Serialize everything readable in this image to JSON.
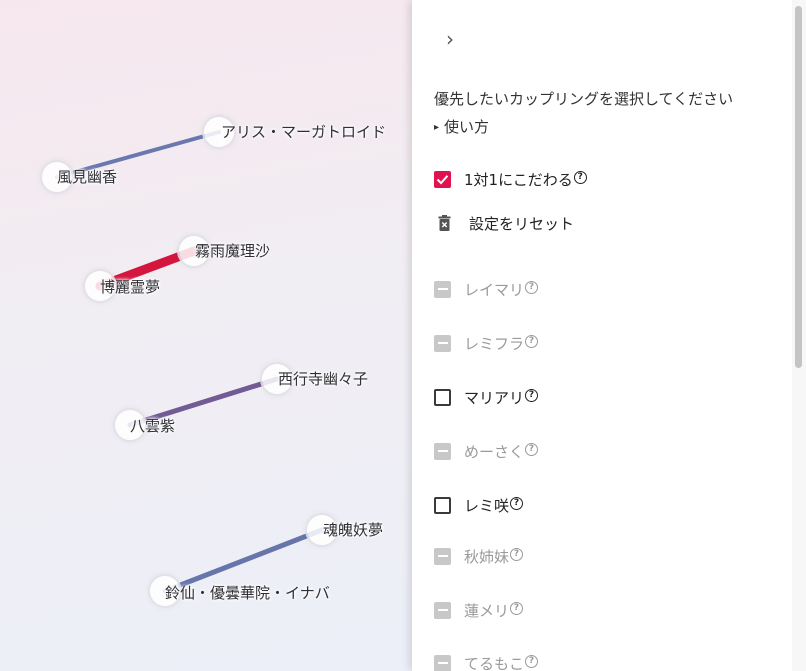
{
  "graph": {
    "edges": [
      {
        "from": "kazami",
        "to": "alice",
        "color": "#6a78ad",
        "weight": 4
      },
      {
        "from": "reimu",
        "to": "marisa",
        "color": "#d4163f",
        "weight": 9
      },
      {
        "from": "yukari",
        "to": "yuyuko",
        "color": "#725a95",
        "weight": 5
      },
      {
        "from": "reisen",
        "to": "youmu",
        "color": "#6676ab",
        "weight": 5
      }
    ],
    "nodes": {
      "kazami": "風見幽香",
      "alice": "アリス・マーガトロイド",
      "reimu": "博麗霊夢",
      "marisa": "霧雨魔理沙",
      "yukari": "八雲紫",
      "yuyuko": "西行寺幽々子",
      "reisen": "鈴仙・優曇華院・イナバ",
      "youmu": "魂魄妖夢"
    }
  },
  "panel": {
    "collapse_icon": "chevron-right-icon",
    "collapse_glyph": "›",
    "intro": "優先したいカップリングを選択してください",
    "howto": "使い方",
    "howto_marker": "▸",
    "one_on_one": {
      "label": "1対1にこだわる",
      "state": "checked"
    },
    "reset": {
      "label": "設定をリセット",
      "icon": "trash-icon"
    },
    "help_glyph": "?",
    "accent": "#e0134f",
    "couplings": [
      {
        "label": "レイマリ",
        "state": "indeterminate"
      },
      {
        "label": "レミフラ",
        "state": "indeterminate"
      },
      {
        "label": "マリアリ",
        "state": "unchecked"
      },
      {
        "label": "めーさく",
        "state": "indeterminate"
      },
      {
        "label": "レミ咲",
        "state": "unchecked"
      },
      {
        "label": "秋姉妹",
        "state": "indeterminate"
      },
      {
        "label": "蓮メリ",
        "state": "indeterminate"
      },
      {
        "label": "てるもこ",
        "state": "indeterminate"
      }
    ]
  }
}
